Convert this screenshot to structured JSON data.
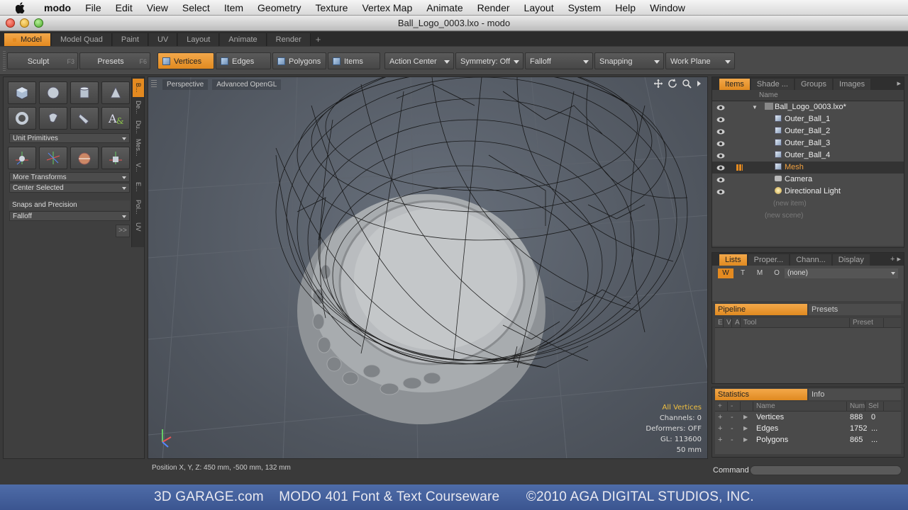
{
  "menubar": {
    "items": [
      "modo",
      "File",
      "Edit",
      "View",
      "Select",
      "Item",
      "Geometry",
      "Texture",
      "Vertex Map",
      "Animate",
      "Render",
      "Layout",
      "System",
      "Help",
      "Window"
    ]
  },
  "window": {
    "title": "Ball_Logo_0003.lxo - modo"
  },
  "layout_tabs": [
    "Model",
    "Model Quad",
    "Paint",
    "UV",
    "Layout",
    "Animate",
    "Render"
  ],
  "toolbar": {
    "sculpt": "Sculpt",
    "sculpt_key": "F3",
    "presets": "Presets",
    "presets_key": "F6",
    "vertices": "Vertices",
    "edges": "Edges",
    "polygons": "Polygons",
    "items": "Items",
    "action_center": "Action Center",
    "symmetry": "Symmetry: Off",
    "falloff": "Falloff",
    "snapping": "Snapping",
    "work_plane": "Work Plane"
  },
  "left_panel": {
    "vtabs": [
      "B...",
      "De...",
      "Du...",
      "Mes...",
      "V...",
      "E...",
      "Pol...",
      "UV"
    ],
    "unit_primitives": "Unit Primitives",
    "more_transforms": "More Transforms",
    "center_selected": "Center Selected",
    "snaps_label": "Snaps and Precision",
    "falloff": "Falloff",
    "more": ">>"
  },
  "viewport": {
    "view": "Perspective",
    "shading": "Advanced OpenGL",
    "info": {
      "mode": "All Vertices",
      "channels": "Channels: 0",
      "deformers": "Deformers: OFF",
      "gl": "GL: 113600",
      "scale": "50 mm"
    }
  },
  "status": {
    "position": "Position X, Y, Z:  450 mm, -500 mm, 132 mm"
  },
  "items_panel": {
    "tabs": [
      "Items",
      "Shade ...",
      "Groups",
      "Images"
    ],
    "header": "Name",
    "scene": "Ball_Logo_0003.lxo*",
    "rows": [
      "Outer_Ball_1",
      "Outer_Ball_2",
      "Outer_Ball_3",
      "Outer_Ball_4",
      "Mesh",
      "Camera",
      "Directional Light"
    ],
    "new_item": "(new item)",
    "new_scene": "(new scene)"
  },
  "lists_panel": {
    "tabs": [
      "Lists",
      "Proper...",
      "Chann...",
      "Display"
    ],
    "wtmo": [
      "W",
      "T",
      "M",
      "O"
    ],
    "none": "(none)",
    "pipeline": "Pipeline",
    "presets": "Presets",
    "cols": [
      "E",
      "V",
      "A",
      "Tool",
      "Preset"
    ]
  },
  "stats_panel": {
    "tabs": [
      "Statistics",
      "Info"
    ],
    "cols": [
      "Name",
      "Num",
      "Sel"
    ],
    "rows": [
      {
        "name": "Vertices",
        "num": "888",
        "sel": "0"
      },
      {
        "name": "Edges",
        "num": "1752",
        "sel": "..."
      },
      {
        "name": "Polygons",
        "num": "865",
        "sel": "..."
      }
    ]
  },
  "command": {
    "label": "Command"
  },
  "banner": {
    "site": "3D GARAGE.com",
    "course": "MODO 401  Font & Text Courseware",
    "copyright": "©2010  AGA DIGITAL STUDIOS, INC."
  }
}
